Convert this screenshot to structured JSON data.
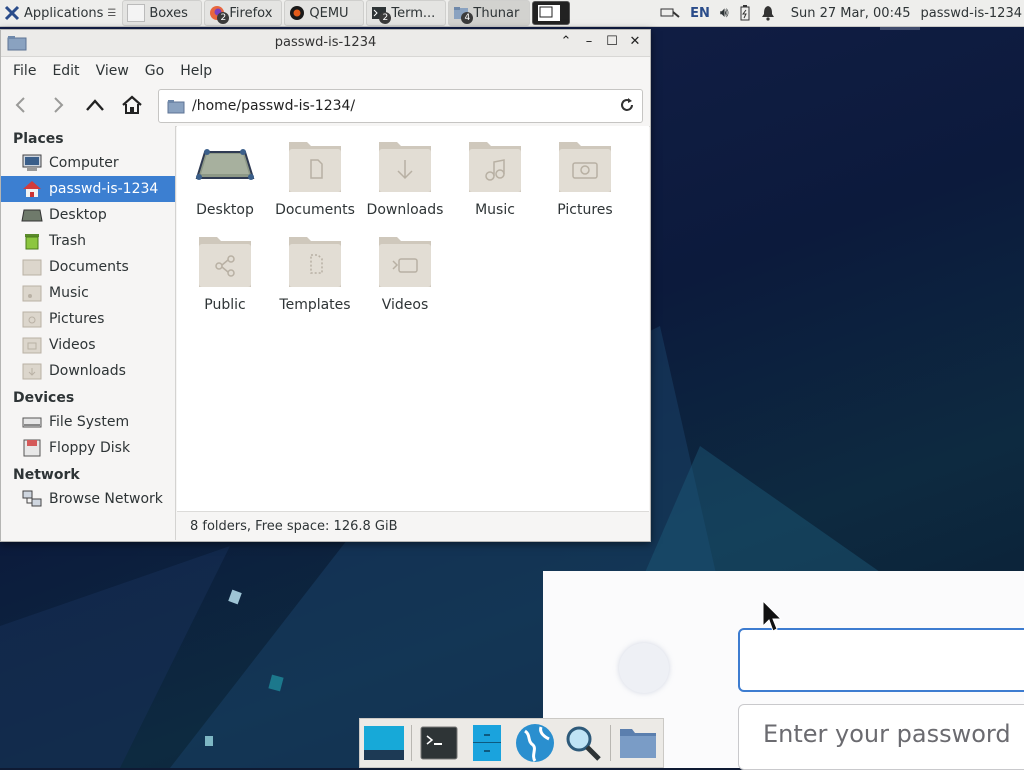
{
  "top_panel": {
    "applications_label": "Applications",
    "tasks": [
      {
        "label": "Boxes",
        "badge": ""
      },
      {
        "label": "Firefox",
        "badge": "2"
      },
      {
        "label": "QEMU",
        "badge": ""
      },
      {
        "label": "Term...",
        "badge": "2"
      },
      {
        "label": "Thunar",
        "badge": "4"
      }
    ],
    "keyboard_layout": "EN",
    "clock": "Sun 27 Mar, 00:45",
    "username": "passwd-is-1234"
  },
  "window": {
    "title": "passwd-is-1234",
    "menu": [
      "File",
      "Edit",
      "View",
      "Go",
      "Help"
    ],
    "location_path": "/home/passwd-is-1234/",
    "sidebar": {
      "places_header": "Places",
      "places": [
        "Computer",
        "passwd-is-1234",
        "Desktop",
        "Trash",
        "Documents",
        "Music",
        "Pictures",
        "Videos",
        "Downloads"
      ],
      "devices_header": "Devices",
      "devices": [
        "File System",
        "Floppy Disk"
      ],
      "network_header": "Network",
      "network": [
        "Browse Network"
      ]
    },
    "files": [
      "Desktop",
      "Documents",
      "Downloads",
      "Music",
      "Pictures",
      "Public",
      "Templates",
      "Videos"
    ],
    "status": "8 folders, Free space: 126.8 GiB"
  },
  "login": {
    "password_placeholder": "Enter your password"
  },
  "colors": {
    "selection": "#3c7fd1",
    "folder": "#dcd6cc",
    "field_focus": "#3d7cd0"
  }
}
